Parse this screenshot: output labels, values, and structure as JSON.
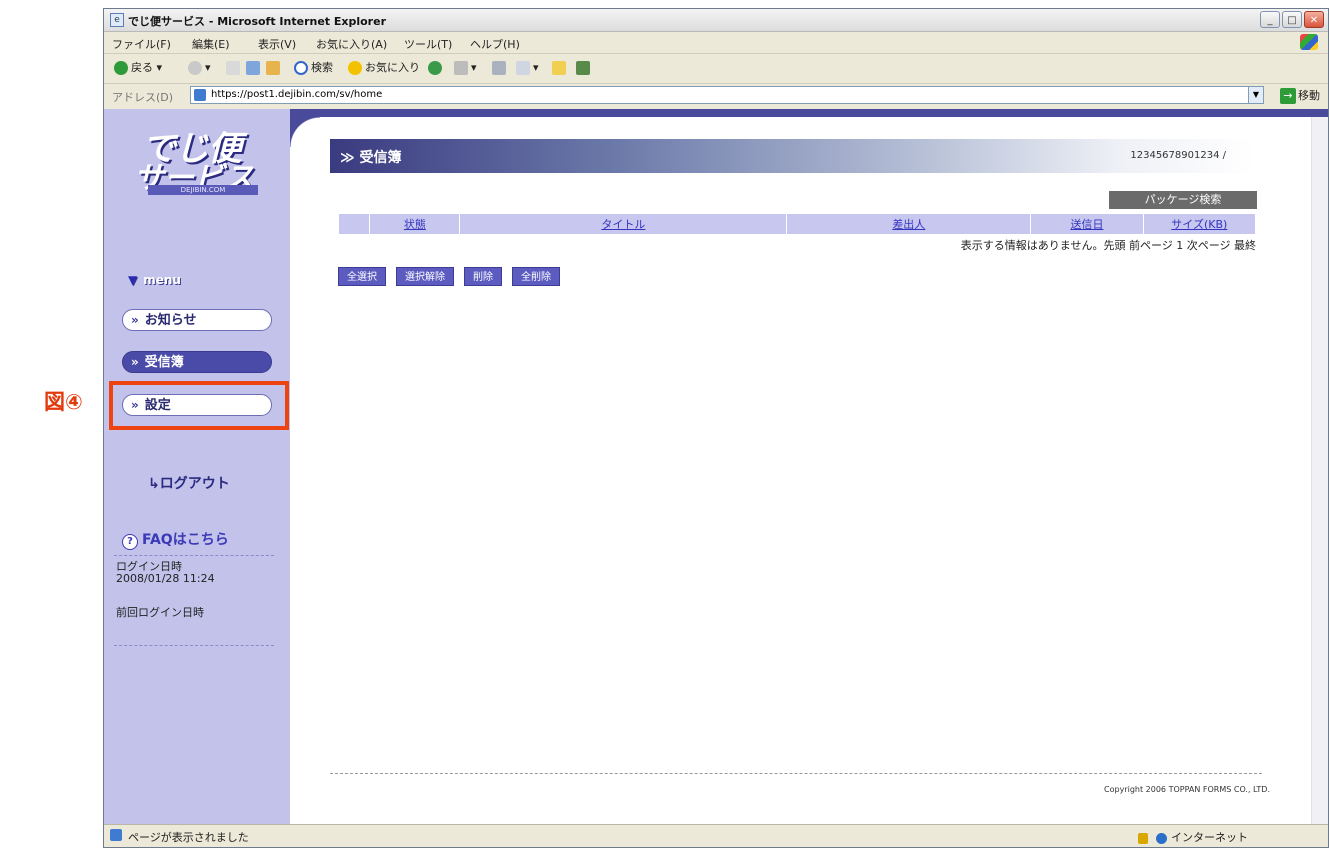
{
  "window": {
    "title": "でじ便サービス - Microsoft Internet Explorer"
  },
  "menubar": {
    "items": [
      "ファイル(F)",
      "編集(E)",
      "表示(V)",
      "お気に入り(A)",
      "ツール(T)",
      "ヘルプ(H)"
    ]
  },
  "toolbar": {
    "back_label": "戻る",
    "search_label": "検索",
    "favorites_label": "お気に入り"
  },
  "address": {
    "label": "アドレス(D)",
    "url": "https://post1.dejibin.com/sv/home",
    "go_label": "移動"
  },
  "sidebar": {
    "logo_line1": "でじ便",
    "logo_line2": "サービス",
    "logo_sub": "DEJIBIN.COM",
    "menu_head": "menu",
    "nav": [
      {
        "label": "お知らせ"
      },
      {
        "label": "受信簿"
      },
      {
        "label": "設定"
      }
    ],
    "logout": "ログアウト",
    "faq": "FAQはこちら",
    "login_label": "ログイン日時",
    "login_value": "2008/01/28 11:24",
    "prev_login_label": "前回ログイン日時"
  },
  "main": {
    "header_title": "受信簿",
    "user_id": "12345678901234 /",
    "package_search": "パッケージ検索",
    "columns": [
      "状態",
      "タイトル",
      "差出人",
      "送信日",
      "サイズ(KB)"
    ],
    "pager": "表示する情報はありません。先頭 前ページ 1 次ページ 最終",
    "buttons": [
      "全選択",
      "選択解除",
      "削除",
      "全削除"
    ],
    "copyright": "Copyright 2006 TOPPAN FORMS CO., LTD."
  },
  "statusbar": {
    "message": "ページが表示されました",
    "zone": "インターネット"
  },
  "annotation": {
    "label": "図④"
  }
}
